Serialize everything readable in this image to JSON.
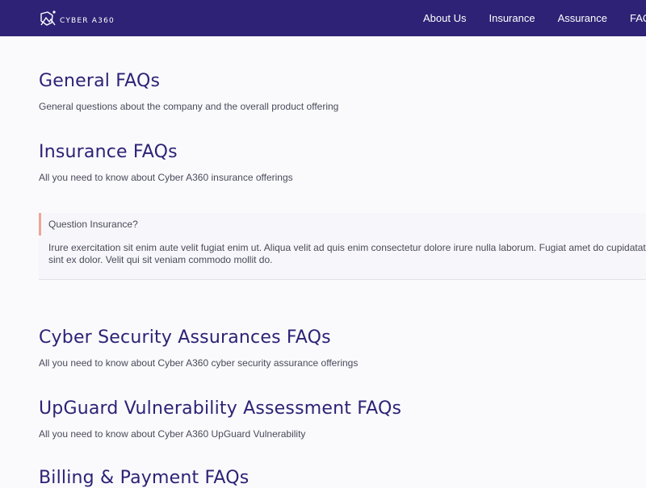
{
  "navbar": {
    "logo_text": "CYBER A360",
    "links": [
      "About Us",
      "Insurance",
      "Assurance",
      "FAQ"
    ]
  },
  "sections": [
    {
      "title": "General FAQs",
      "description": "General questions about the company and the overall product offering"
    },
    {
      "title": "Insurance FAQs",
      "description": "All you need to know about Cyber A360 insurance offerings"
    },
    {
      "title": "Cyber Security Assurances FAQs",
      "description": "All you need to know about Cyber A360 cyber security assurance offerings"
    },
    {
      "title": "UpGuard Vulnerability Assessment FAQs",
      "description": "All you need to know about Cyber A360 UpGuard Vulnerability"
    },
    {
      "title": "Billing & Payment FAQs"
    }
  ],
  "faq": {
    "question": "Question Insurance?",
    "answer": "Irure exercitation sit enim aute velit fugiat enim ut. Aliqua velit ad quis enim consectetur dolore irure nulla laborum. Fugiat amet do cupidatat sint ex dolor. Velit qui sit veniam commodo mollit do."
  },
  "colors": {
    "navbar_bg": "#2d2275",
    "heading": "#2d2275",
    "accent_border": "#f0a397"
  }
}
